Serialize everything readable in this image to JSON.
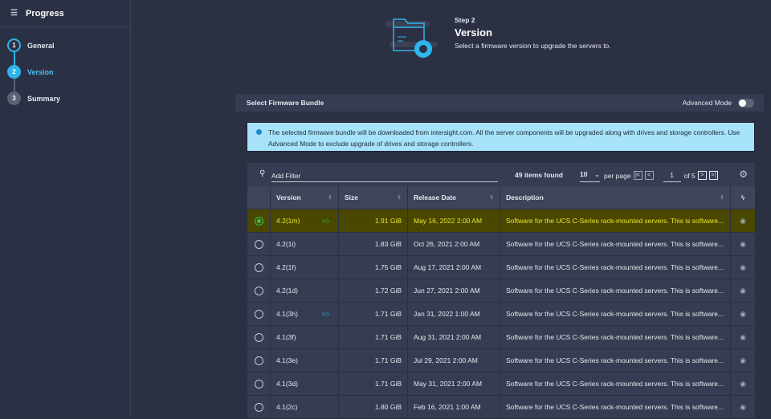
{
  "sidebar": {
    "title": "Progress",
    "steps": [
      {
        "num": "1",
        "label": "General",
        "state": "done"
      },
      {
        "num": "2",
        "label": "Version",
        "state": "active"
      },
      {
        "num": "3",
        "label": "Summary",
        "state": "pending"
      }
    ]
  },
  "header": {
    "step": "Step 2",
    "title": "Version",
    "subtitle": "Select a firmware version to upgrade the servers to."
  },
  "panel": {
    "title": "Select Firmware Bundle",
    "advanced_mode_label": "Advanced Mode",
    "advanced_mode": false
  },
  "info": "The selected firmware bundle will be downloaded from intersight.com. All the server components will be upgraded along with drives and storage controllers. Use Advanced Mode to exclude upgrade of drives and storage controllers.",
  "table": {
    "filter_placeholder": "Add Filter",
    "items_found": "49 items found",
    "per_page_value": "10",
    "per_page_label": "per page",
    "page": "1",
    "of_pages": "of 5",
    "columns": [
      "Version",
      "Size",
      "Release Date",
      "Description"
    ],
    "rows": [
      {
        "version": "4.2(1m)",
        "recommended": "green",
        "size": "1.91 GiB",
        "date": "May 16, 2022 2:00 AM",
        "desc": "Software for the UCS C-Series rack-mounted servers. This is software...",
        "selected": true
      },
      {
        "version": "4.2(1i)",
        "size": "1.83 GiB",
        "date": "Oct 26, 2021 2:00 AM",
        "desc": "Software for the UCS C-Series rack-mounted servers. This is software..."
      },
      {
        "version": "4.2(1f)",
        "size": "1.75 GiB",
        "date": "Aug 17, 2021 2:00 AM",
        "desc": "Software for the UCS C-Series rack-mounted servers. This is software..."
      },
      {
        "version": "4.2(1d)",
        "size": "1.72 GiB",
        "date": "Jun 27, 2021 2:00 AM",
        "desc": "Software for the UCS C-Series rack-mounted servers. This is software..."
      },
      {
        "version": "4.1(3h)",
        "recommended": "blue",
        "size": "1.71 GiB",
        "date": "Jan 31, 2022 1:00 AM",
        "desc": "Software for the UCS C-Series rack-mounted servers. This is software..."
      },
      {
        "version": "4.1(3f)",
        "size": "1.71 GiB",
        "date": "Aug 31, 2021 2:00 AM",
        "desc": "Software for the UCS C-Series rack-mounted servers. This is software..."
      },
      {
        "version": "4.1(3e)",
        "size": "1.71 GiB",
        "date": "Jul 29, 2021 2:00 AM",
        "desc": "Software for the UCS C-Series rack-mounted servers. This is software..."
      },
      {
        "version": "4.1(3d)",
        "size": "1.71 GiB",
        "date": "May 31, 2021 2:00 AM",
        "desc": "Software for the UCS C-Series rack-mounted servers. This is software..."
      },
      {
        "version": "4.1(2c)",
        "size": "1.80 GiB",
        "date": "Feb 16, 2021 1:00 AM",
        "desc": "Software for the UCS C-Series rack-mounted servers. This is software..."
      }
    ]
  },
  "colors": {
    "accent": "#2fb5ef",
    "selected_row": "#4a4800",
    "selected_text": "#e8e82a",
    "info_bg": "#a6e2f9"
  }
}
